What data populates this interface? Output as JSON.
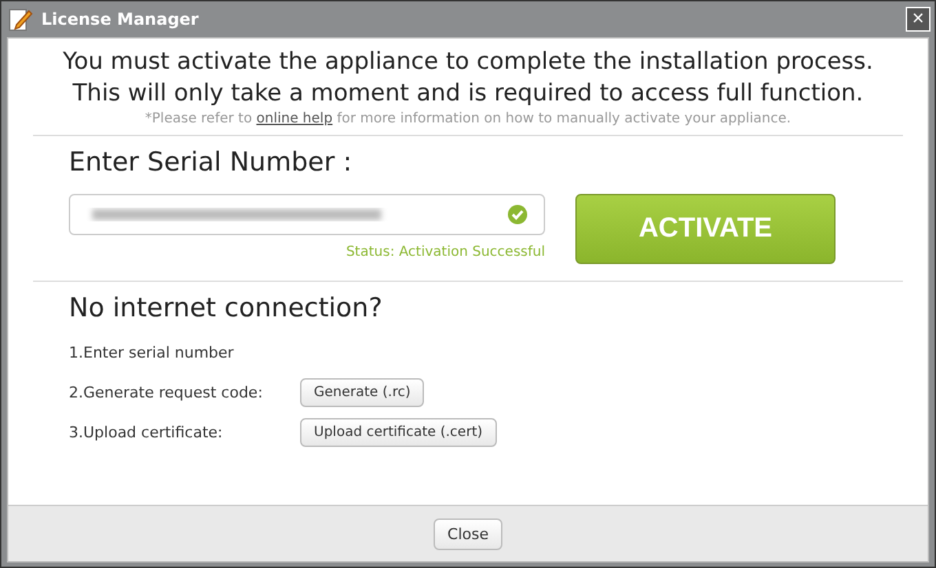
{
  "window": {
    "title": "License Manager",
    "close": "×"
  },
  "intro": {
    "lines": [
      "You must activate the appliance to complete the installation process.",
      "This will only take a moment and is required to access full function."
    ],
    "note_before": "*Please refer to ",
    "note_link": "online help",
    "note_after": " for more information on how to manually activate your appliance."
  },
  "serial": {
    "heading": "Enter Serial Number :",
    "valid": true,
    "status": "Status: Activation Successful",
    "button": "ACTIVATE"
  },
  "offline": {
    "heading": "No internet connection?",
    "steps": [
      {
        "label": "1.Enter serial number"
      },
      {
        "label": "2.Generate request code:",
        "button": "Generate (.rc)"
      },
      {
        "label": "3.Upload certificate:",
        "button": "Upload certificate (.cert)"
      }
    ]
  },
  "footer": {
    "button": "Close"
  }
}
